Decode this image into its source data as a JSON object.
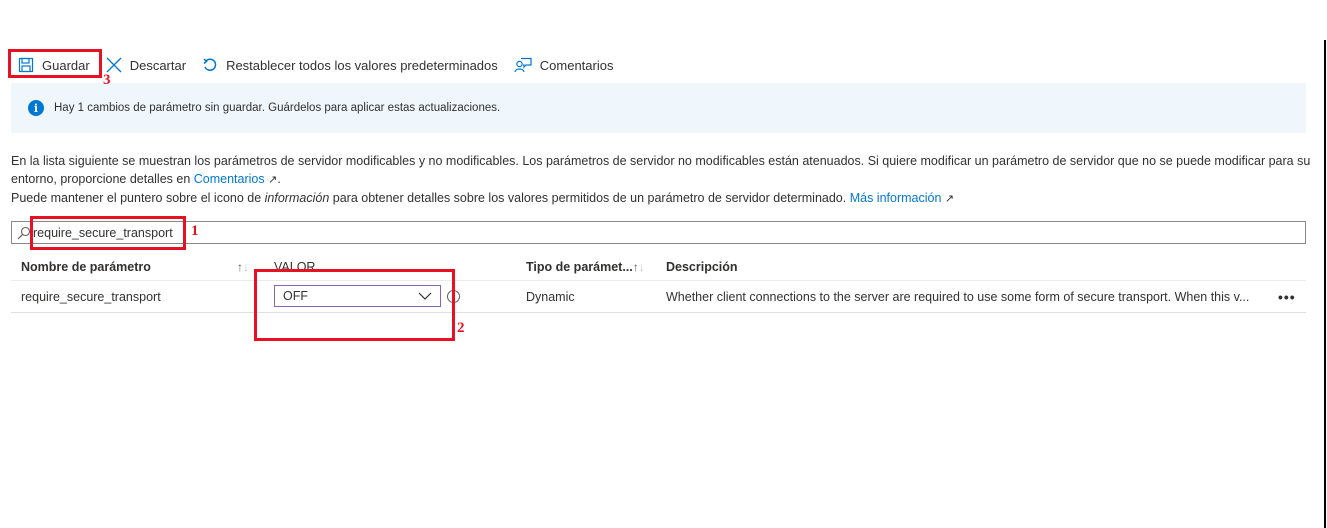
{
  "toolbar": {
    "save_label": "Guardar",
    "discard_label": "Descartar",
    "reset_label": "Restablecer todos los valores predeterminados",
    "feedback_label": "Comentarios"
  },
  "banner": {
    "message": "Hay 1 cambios de parámetro sin guardar. Guárdelos para aplicar estas actualizaciones."
  },
  "description": {
    "line1": "En la lista siguiente se muestran los parámetros de servidor modificables y no modificables. Los parámetros de servidor no modificables están atenuados. Si quiere modificar un parámetro de servidor que no se puede modificar para su entorno, proporcione detalles en ",
    "line1_link": "Comentarios",
    "line2_pre": "Puede mantener el puntero sobre el icono de ",
    "line2_em": "información",
    "line2_post": " para obtener detalles sobre los valores permitidos de un parámetro de servidor determinado. ",
    "line2_link": "Más información"
  },
  "search": {
    "value": "require_secure_transport"
  },
  "table": {
    "headers": {
      "name": "Nombre de parámetro",
      "value": "VALOR",
      "type": "Tipo de parámet...",
      "description": "Descripción"
    },
    "rows": [
      {
        "name": "require_secure_transport",
        "value": "OFF",
        "type": "Dynamic",
        "description": "Whether client connections to the server are required to use some form of secure transport. When this v...",
        "more": "•••"
      }
    ]
  },
  "annotations": {
    "search": "1",
    "value": "2",
    "save": "3"
  },
  "colors": {
    "accent": "#0078d4",
    "annotation_red": "#e81123",
    "select_border": "#8764b8",
    "banner_bg": "#eff6fc"
  }
}
